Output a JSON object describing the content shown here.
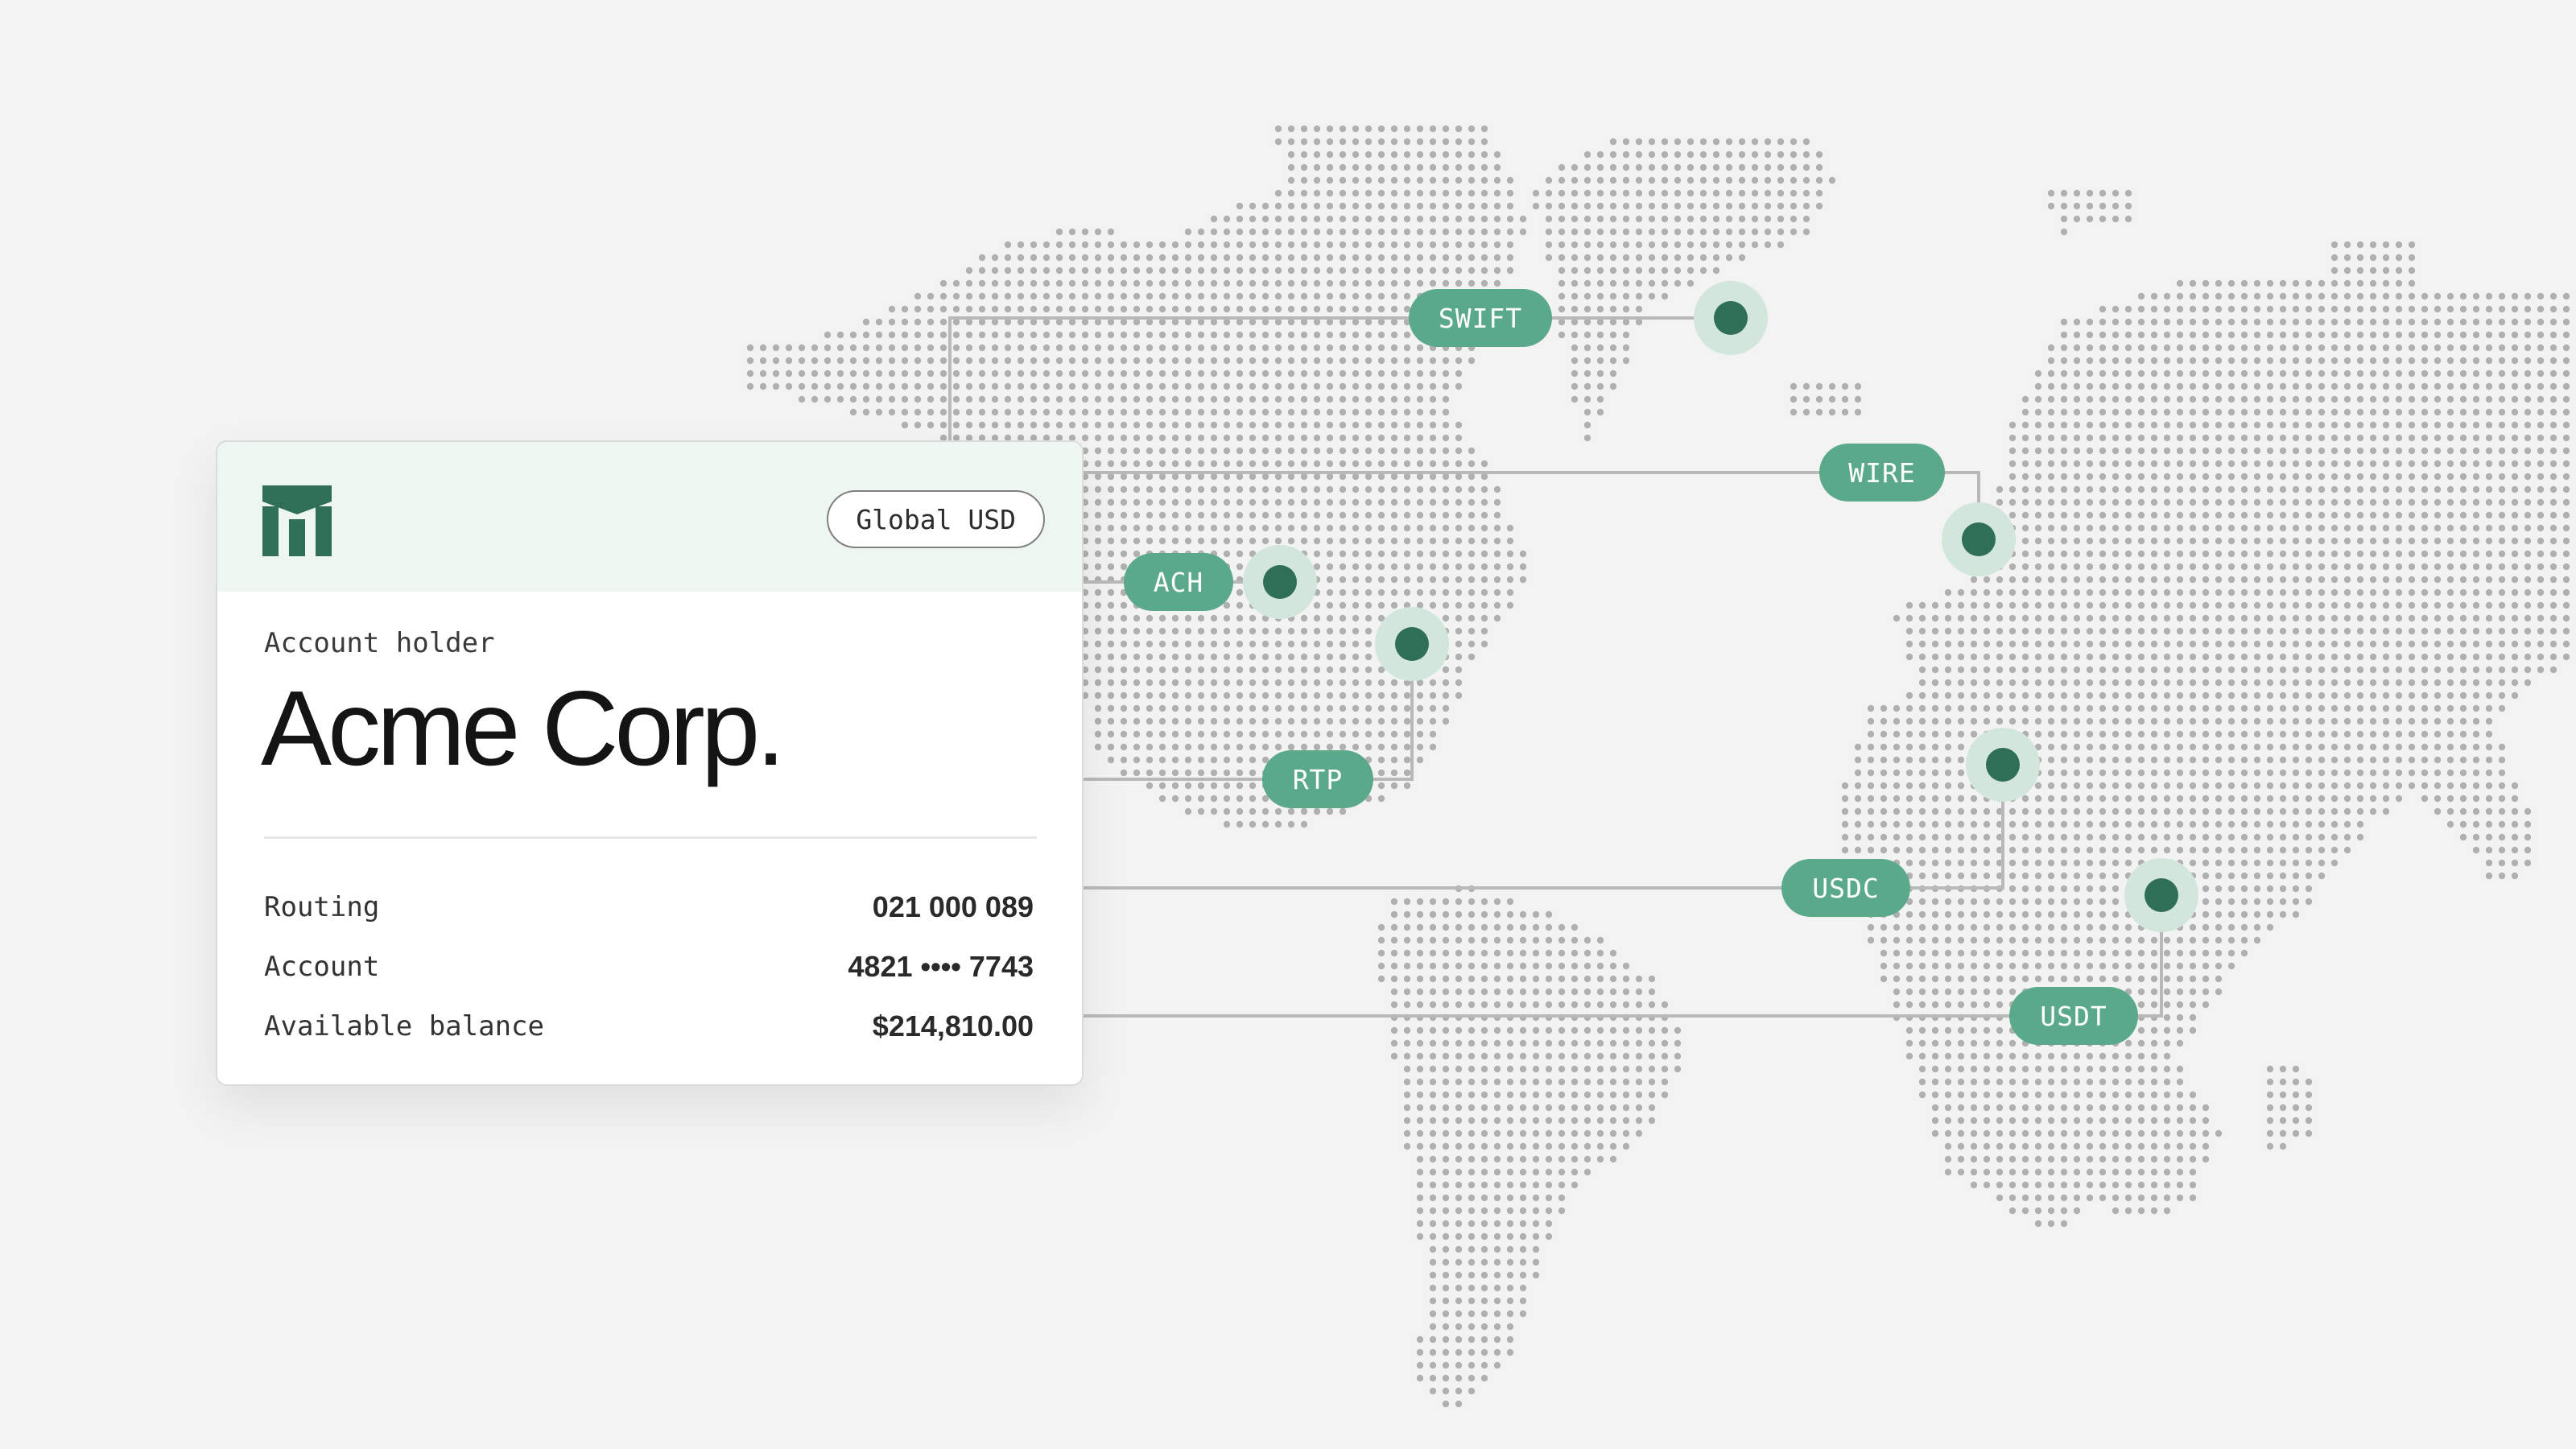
{
  "card": {
    "currency_badge": "Global USD",
    "holder_label": "Account holder",
    "holder_name": "Acme Corp.",
    "details": [
      {
        "label": "Routing",
        "value": "021 000 089"
      },
      {
        "label": "Account",
        "value": "4821 •••• 7743"
      },
      {
        "label": "Available balance",
        "value": "$214,810.00"
      }
    ]
  },
  "rails": [
    "SWIFT",
    "WIRE",
    "ACH",
    "RTP",
    "USDC",
    "USDT"
  ],
  "colors": {
    "background": "#f3f3f3",
    "map_dot": "#b0b0b0",
    "pill": "#5aa98a",
    "node": "#2f6f58",
    "node_halo": "#d3e6dc",
    "line": "#b9b9b9",
    "brand": "#2f6f58"
  }
}
